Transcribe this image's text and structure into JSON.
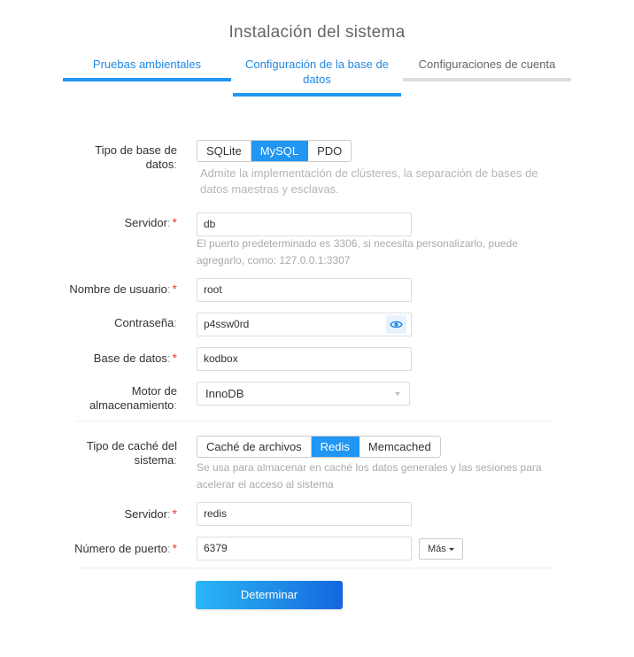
{
  "page": {
    "title": "Instalación del sistema"
  },
  "steps": [
    {
      "label": "Pruebas ambientales",
      "state": "done"
    },
    {
      "label": "Configuración de la base de datos",
      "state": "active"
    },
    {
      "label": "Configuraciones de cuenta",
      "state": "pending"
    }
  ],
  "form": {
    "db_type": {
      "label": "Tipo de base de datos",
      "options": [
        "SQLite",
        "MySQL",
        "PDO"
      ],
      "selected": "MySQL",
      "help": "Admite la implementación de clústeres, la separación de bases de datos maestras y esclavas."
    },
    "server": {
      "label": "Servidor",
      "value": "db",
      "help": "El puerto predeterminado es 3306, si necesita personalizarlo, puede agregarlo, como: 127.0.0.1:3307"
    },
    "username": {
      "label": "Nombre de usuario",
      "value": "root"
    },
    "password": {
      "label": "Contraseña",
      "value": "p4ssw0rd"
    },
    "database": {
      "label": "Base de datos",
      "value": "kodbox"
    },
    "engine": {
      "label": "Motor de almacenamiento",
      "value": "InnoDB"
    },
    "cache_type": {
      "label": "Tipo de caché del sistema",
      "options": [
        "Caché de archivos",
        "Redis",
        "Memcached"
      ],
      "selected": "Redis",
      "help": "Se usa para almacenar en caché los datos generales y las sesiones para acelerar el acceso al sistema"
    },
    "cache_server": {
      "label": "Servidor",
      "value": "redis"
    },
    "cache_port": {
      "label": "Número de puerto",
      "value": "6379",
      "more_label": "Más"
    },
    "colon": ":",
    "required_mark": "*",
    "submit_label": "Determinar"
  },
  "colors": {
    "accent": "#2196f3",
    "required": "#e53935"
  },
  "icons": {
    "password_toggle": "eye-icon"
  }
}
